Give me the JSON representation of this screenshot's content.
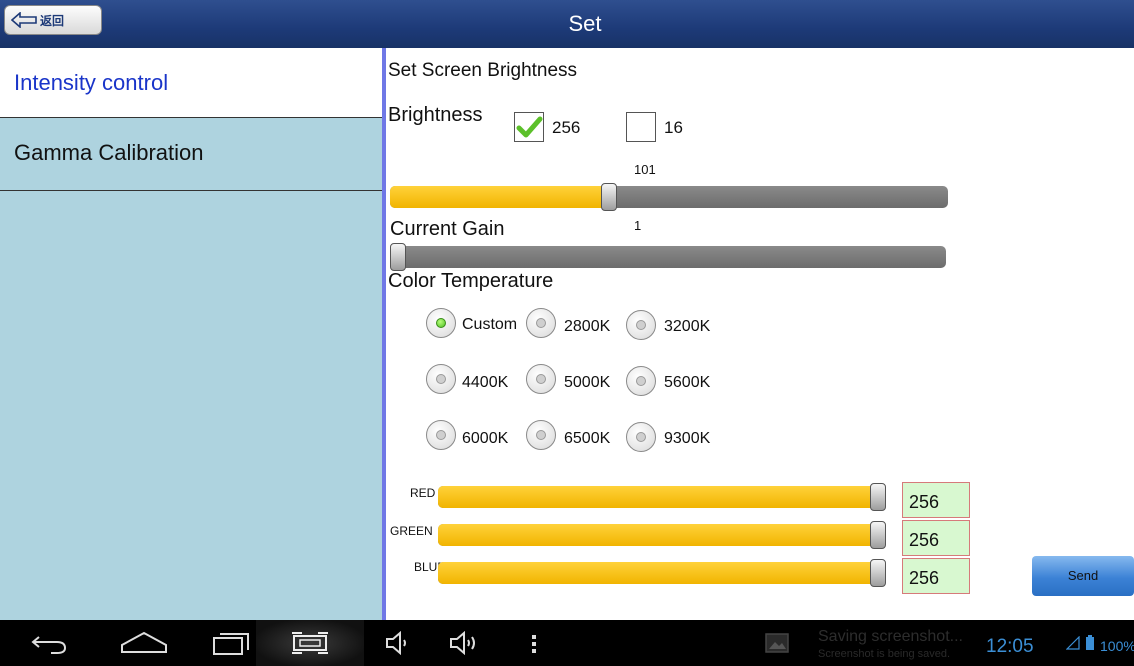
{
  "topbar": {
    "back_label": "返回",
    "title": "Set"
  },
  "sidebar": {
    "items": [
      {
        "label": "Intensity control",
        "active": true
      },
      {
        "label": "Gamma Calibration",
        "active": false
      }
    ]
  },
  "main": {
    "section_title": "Set Screen Brightness",
    "brightness": {
      "label": "Brightness",
      "opt1": "256",
      "opt1_checked": true,
      "opt2": "16",
      "opt2_checked": false,
      "slider_value": "101",
      "slider_fraction": 0.39
    },
    "gain": {
      "label": "Current Gain",
      "slider_value": "1",
      "slider_fraction": 0.0
    },
    "color_temp": {
      "label": "Color Temperature",
      "options": [
        "Custom",
        "2800K",
        "3200K",
        "4400K",
        "5000K",
        "5600K",
        "6000K",
        "6500K",
        "9300K"
      ],
      "selected": "Custom"
    },
    "rgb": [
      {
        "label": "RED",
        "value": "256",
        "fraction": 1.0
      },
      {
        "label": "GREEN",
        "value": "256",
        "fraction": 1.0
      },
      {
        "label": "BLUE",
        "value": "256",
        "fraction": 1.0
      }
    ],
    "send_label": "Send"
  },
  "statusbar": {
    "toast_title": "Saving screenshot...",
    "toast_sub": "Screenshot is being saved.",
    "clock": "12:05",
    "battery": "100%"
  },
  "icons": [
    "back-arrow-icon",
    "home-icon",
    "recent-apps-icon",
    "screenshot-icon",
    "volume-down-icon",
    "volume-up-icon",
    "menu-dots-icon",
    "gallery-icon",
    "signal-icon",
    "battery-icon"
  ]
}
